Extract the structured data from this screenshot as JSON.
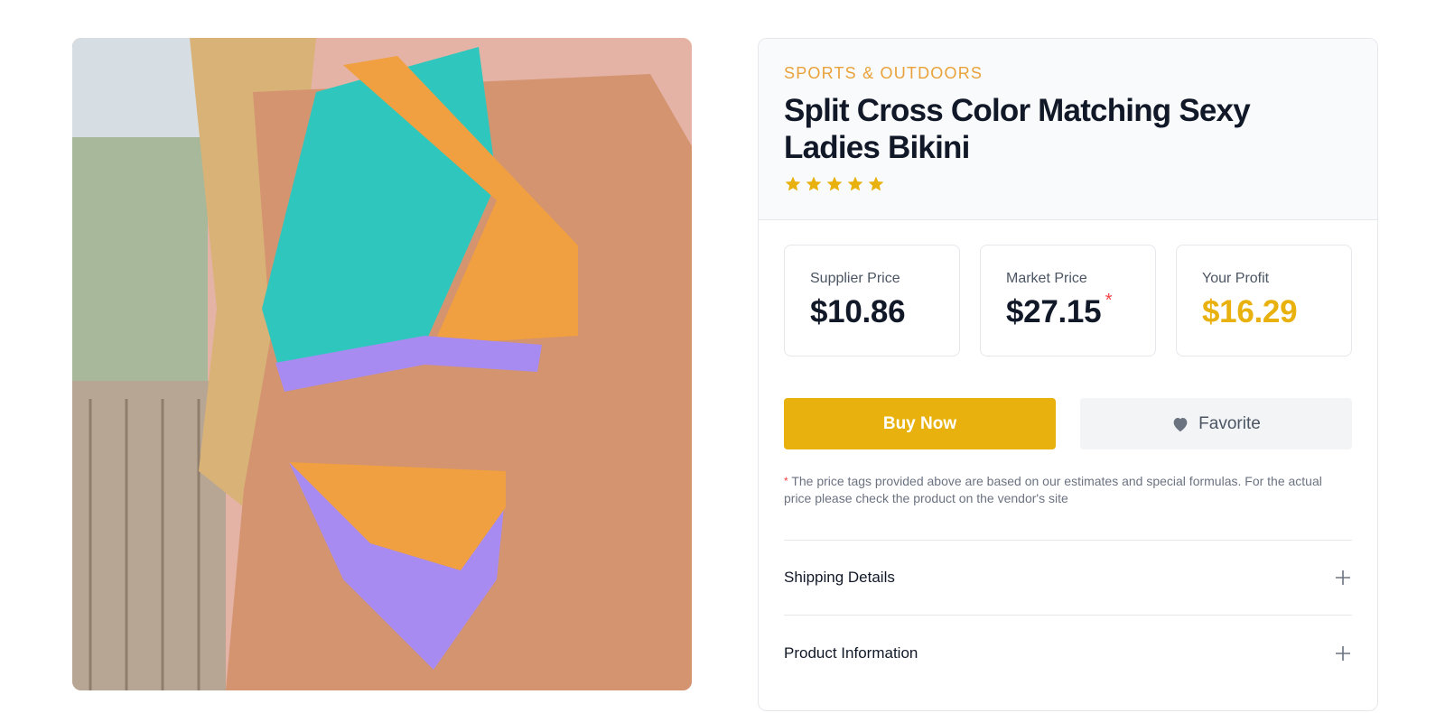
{
  "product": {
    "category": "SPORTS & OUTDOORS",
    "title": "Split Cross Color Matching Sexy Ladies Bikini",
    "rating": 5,
    "image_alt": "product-photo"
  },
  "prices": {
    "supplier": {
      "label": "Supplier Price",
      "value": "$10.86"
    },
    "market": {
      "label": "Market Price",
      "value": "$27.15",
      "marker": "*"
    },
    "profit": {
      "label": "Your Profit",
      "value": "$16.29"
    }
  },
  "actions": {
    "buy_label": "Buy Now",
    "favorite_label": "Favorite"
  },
  "note": {
    "marker": "*",
    "text": "The price tags provided above are based on our estimates and special formulas. For the actual price please check the product on the vendor's site"
  },
  "accordion": [
    {
      "label": "Shipping Details"
    },
    {
      "label": "Product Information"
    }
  ],
  "colors": {
    "accent": "#e8b10e",
    "category": "#e9a23b",
    "asterisk": "#ef4444"
  },
  "icons": {
    "star": "star-icon",
    "heart": "heart-icon",
    "plus": "plus-icon"
  }
}
